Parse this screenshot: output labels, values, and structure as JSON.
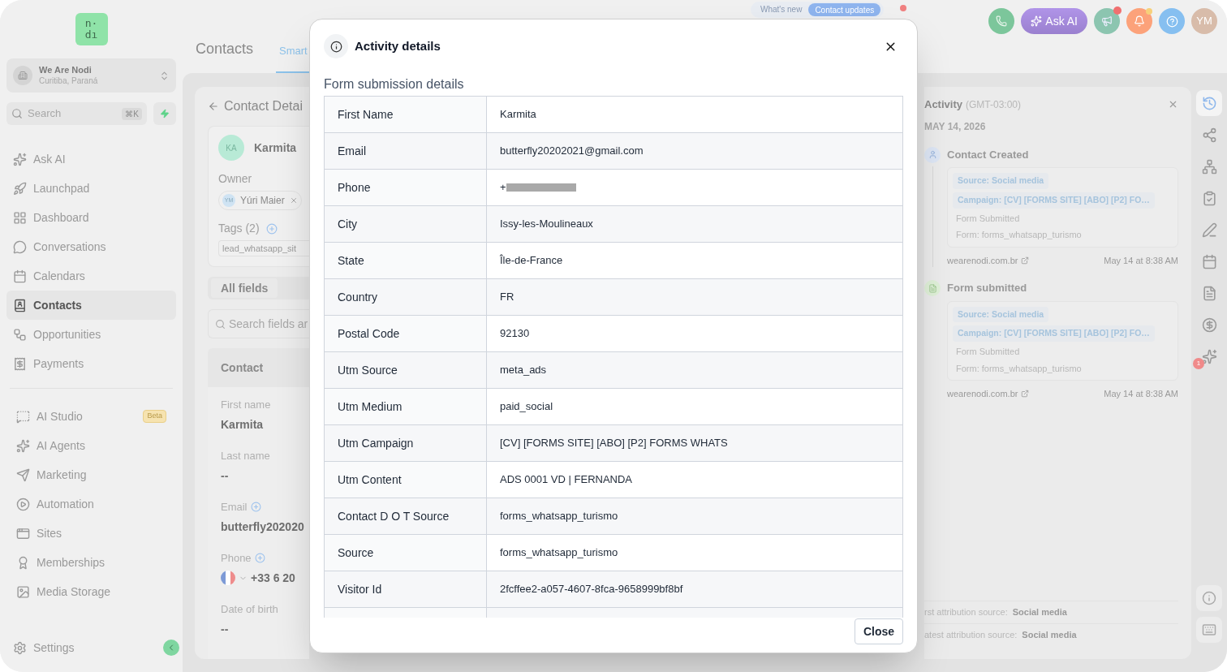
{
  "sidebar": {
    "logo": [
      "n·",
      "dı"
    ],
    "workspace": {
      "name": "We Are Nodi",
      "location": "Curitiba, Paraná"
    },
    "search": {
      "placeholder": "Search",
      "shortcut": "⌘K"
    },
    "nav_groups": [
      [
        {
          "label": "Ask AI",
          "selected": false
        },
        {
          "label": "Launchpad",
          "selected": false
        },
        {
          "label": "Dashboard",
          "selected": false
        },
        {
          "label": "Conversations",
          "selected": false
        },
        {
          "label": "Calendars",
          "selected": false
        },
        {
          "label": "Contacts",
          "selected": true
        },
        {
          "label": "Opportunities",
          "selected": false
        },
        {
          "label": "Payments",
          "selected": false
        }
      ],
      [
        {
          "label": "AI Studio",
          "selected": false,
          "badge": "Beta"
        },
        {
          "label": "AI Agents",
          "selected": false
        },
        {
          "label": "Marketing",
          "selected": false
        },
        {
          "label": "Automation",
          "selected": false
        },
        {
          "label": "Sites",
          "selected": false
        },
        {
          "label": "Memberships",
          "selected": false
        },
        {
          "label": "Media Storage",
          "selected": false
        }
      ]
    ],
    "settings": "Settings"
  },
  "header": {
    "title": "Contacts",
    "tabs": [
      {
        "label": "Smart",
        "selected": true
      }
    ],
    "announcement": {
      "label": "What's new",
      "pill": "Contact updates"
    },
    "ask_ai": "Ask AI",
    "avatar": "YM"
  },
  "contact_panel": {
    "back": "Contact Detai",
    "initials": "KA",
    "name": "Karmita",
    "owner_label": "Owner",
    "owner": {
      "initials": "YM",
      "name": "Yúri Maier"
    },
    "tags_label": "Tags (2)",
    "tag": "lead_whatsapp_sit",
    "tabs": [
      {
        "label": "All fields",
        "selected": true
      }
    ],
    "search_placeholder": "Search fields ar",
    "section": "Contact",
    "fields": [
      {
        "label": "First name",
        "value": "Karmita",
        "addable": false
      },
      {
        "label": "Last name",
        "value": "--",
        "addable": false
      },
      {
        "label": "Email",
        "value": "butterfly202020",
        "addable": true
      },
      {
        "label": "Phone",
        "value": "+33 6 20",
        "addable": true,
        "kind": "phone"
      },
      {
        "label": "Date of birth",
        "value": "--",
        "addable": false
      }
    ]
  },
  "activity": {
    "title": "Activity",
    "timezone": "(GMT-03:00)",
    "date": "MAY 14, 2026",
    "events": [
      {
        "kind": "contact",
        "title": "Contact Created",
        "tags": [
          "Source: Social media",
          "Campaign: [CV] [FORMS SITE] [ABO] [P2] FO…"
        ],
        "lines": [
          "Form Submitted",
          "Form: forms_whatsapp_turismo"
        ],
        "site": "wearenodi.com.br",
        "time": "May 14 at 8:38 AM"
      },
      {
        "kind": "form",
        "title": "Form submitted",
        "tags": [
          "Source: Social media",
          "Campaign: [CV] [FORMS SITE] [ABO] [P2] FO…"
        ],
        "lines": [
          "Form Submitted",
          "Form: forms_whatsapp_turismo"
        ],
        "site": "wearenodi.com.br",
        "time": "May 14 at 8:38 AM"
      }
    ],
    "attribution": [
      {
        "label": "rst attribution source:",
        "value": "Social media"
      },
      {
        "label": "atest attribution source:",
        "value": "Social media"
      }
    ]
  },
  "rail": [
    {
      "selected": true
    },
    {
      "selected": false
    },
    {
      "selected": false
    },
    {
      "selected": false
    },
    {
      "selected": false
    },
    {
      "selected": false
    },
    {
      "selected": false
    },
    {
      "selected": false
    },
    {
      "selected": false,
      "badge": "1"
    }
  ],
  "modal": {
    "title": "Activity details",
    "subtitle": "Form submission details",
    "rows": [
      {
        "label": "First Name",
        "value": "Karmita"
      },
      {
        "label": "Email",
        "value": "butterfly20202021@gmail.com"
      },
      {
        "label": "Phone",
        "value": "+",
        "redacted": true
      },
      {
        "label": "City",
        "value": "Issy-les-Moulineaux"
      },
      {
        "label": "State",
        "value": "Île-de-France"
      },
      {
        "label": "Country",
        "value": "FR"
      },
      {
        "label": "Postal Code",
        "value": "92130"
      },
      {
        "label": "Utm Source",
        "value": "meta_ads"
      },
      {
        "label": "Utm Medium",
        "value": "paid_social"
      },
      {
        "label": "Utm Campaign",
        "value": "[CV] [FORMS SITE] [ABO] [P2] FORMS WHATS"
      },
      {
        "label": "Utm Content",
        "value": "ADS 0001 VD | FERNANDA"
      },
      {
        "label": "Contact D O T Source",
        "value": "forms_whatsapp_turismo"
      },
      {
        "label": "Source",
        "value": "forms_whatsapp_turismo"
      },
      {
        "label": "Visitor Id",
        "value": "2fcffee2-a057-4607-8fca-9658999bf8bf"
      }
    ],
    "close": "Close"
  }
}
